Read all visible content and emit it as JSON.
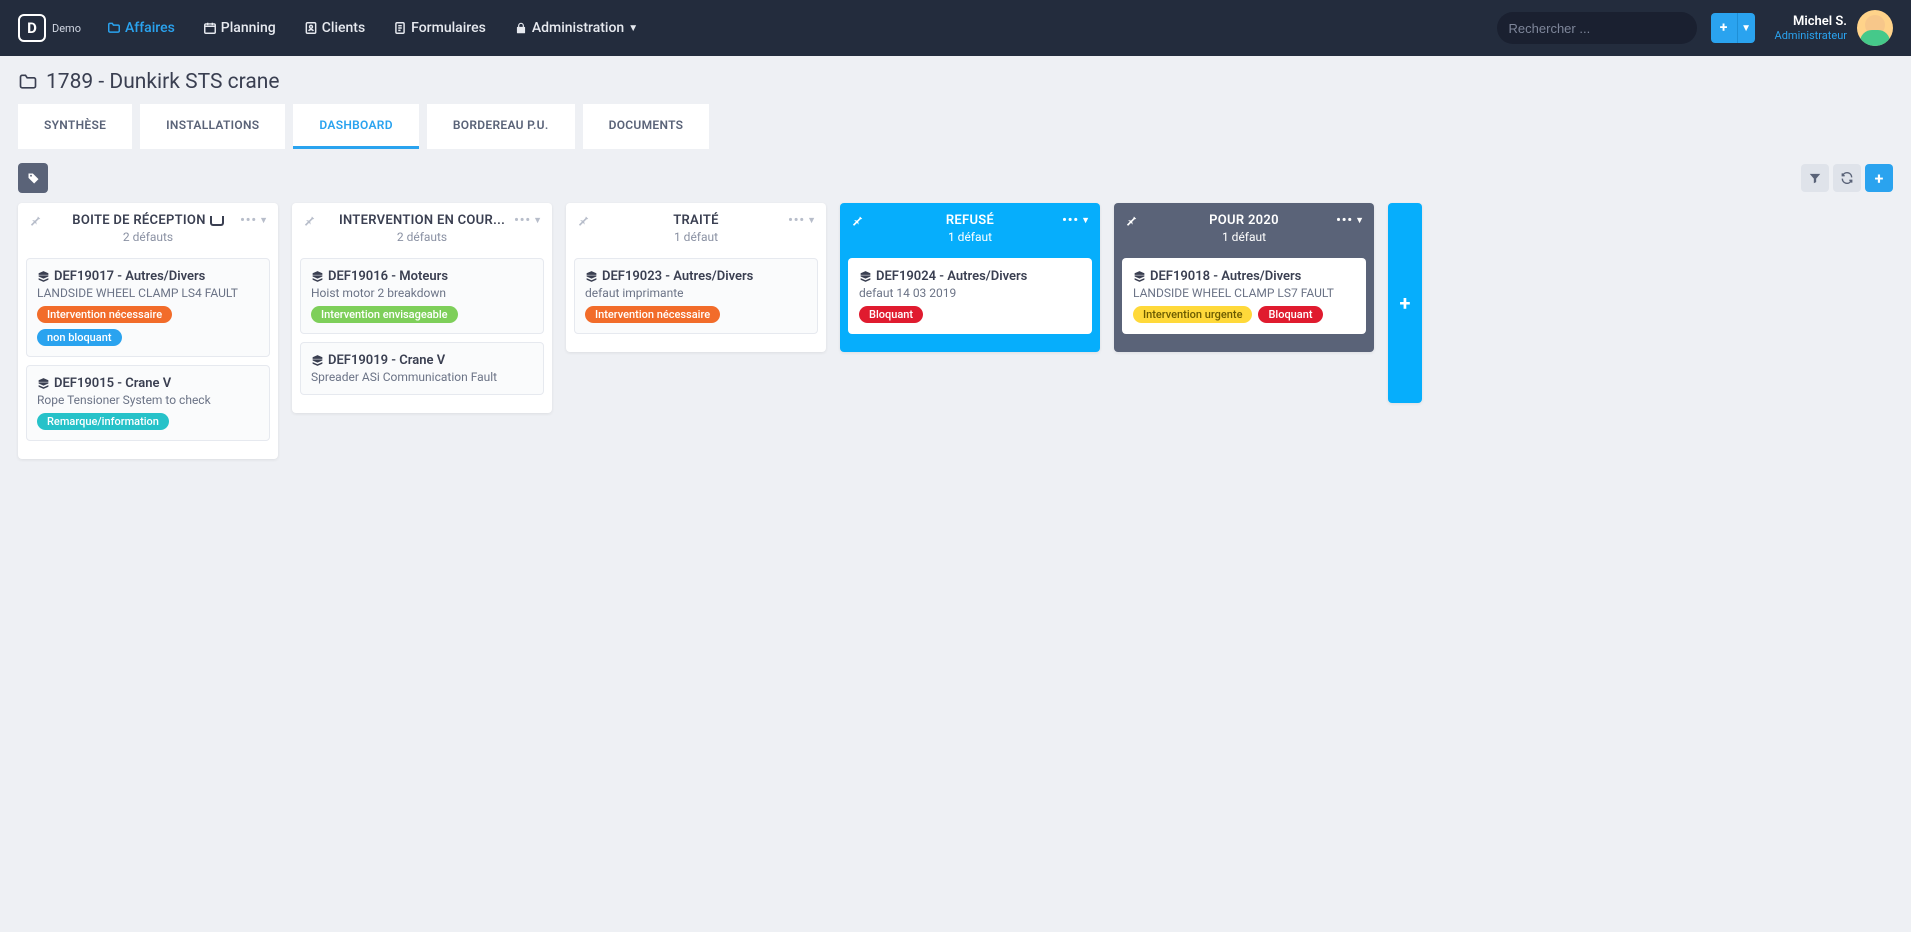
{
  "brand": {
    "logo_letter": "D",
    "demo": "Demo"
  },
  "nav": {
    "affaires": "Affaires",
    "planning": "Planning",
    "clients": "Clients",
    "formulaires": "Formulaires",
    "administration": "Administration"
  },
  "search": {
    "placeholder": "Rechercher ..."
  },
  "user": {
    "name": "Michel S.",
    "role": "Administrateur"
  },
  "page": {
    "title": "1789 - Dunkirk STS crane"
  },
  "tabs": {
    "synthese": "SYNTHÈSE",
    "installations": "INSTALLATIONS",
    "dashboard": "DASHBOARD",
    "bordereau": "BORDEREAU P.U.",
    "documents": "DOCUMENTS"
  },
  "colors": {
    "orange": "#f26c2a",
    "blue": "#2aa3ef",
    "green": "#7ecf5a",
    "red": "#e01b2f",
    "yellow": "#ffd93a",
    "teal": "#26c2c9"
  },
  "columns": [
    {
      "title": "BOITE DE RÉCEPTION",
      "inbox_icon": true,
      "sub": "2 défauts",
      "style": "white",
      "cards": [
        {
          "title": "DEF19017 - Autres/Divers",
          "desc": "LANDSIDE WHEEL CLAMP LS4 FAULT",
          "badges": [
            {
              "text": "Intervention nécessaire",
              "color": "orange"
            },
            {
              "text": "non bloquant",
              "color": "blue"
            }
          ]
        },
        {
          "title": "DEF19015 - Crane V",
          "desc": "Rope Tensioner System to check",
          "badges": [
            {
              "text": "Remarque/information",
              "color": "teal"
            }
          ]
        }
      ]
    },
    {
      "title": "INTERVENTION EN COUR...",
      "sub": "2 défauts",
      "style": "white",
      "cards": [
        {
          "title": "DEF19016 - Moteurs",
          "desc": "Hoist motor 2 breakdown",
          "badges": [
            {
              "text": "Intervention envisageable",
              "color": "green"
            }
          ]
        },
        {
          "title": "DEF19019 - Crane V",
          "desc": "Spreader ASi Communication Fault",
          "badges": []
        }
      ]
    },
    {
      "title": "TRAITÉ",
      "sub": "1 défaut",
      "style": "white",
      "cards": [
        {
          "title": "DEF19023 - Autres/Divers",
          "desc": "defaut imprimante",
          "badges": [
            {
              "text": "Intervention nécessaire",
              "color": "orange"
            }
          ]
        }
      ]
    },
    {
      "title": "REFUSÉ",
      "sub": "1 défaut",
      "style": "blue",
      "cards": [
        {
          "title": "DEF19024 - Autres/Divers",
          "desc": "defaut 14 03 2019",
          "badges": [
            {
              "text": "Bloquant",
              "color": "red"
            }
          ]
        }
      ]
    },
    {
      "title": "POUR 2020",
      "sub": "1 défaut",
      "style": "gray",
      "cards": [
        {
          "title": "DEF19018 - Autres/Divers",
          "desc": "LANDSIDE WHEEL CLAMP LS7 FAULT",
          "badges": [
            {
              "text": "Intervention urgente",
              "color": "yellow"
            },
            {
              "text": "Bloquant",
              "color": "red"
            }
          ]
        }
      ]
    }
  ]
}
